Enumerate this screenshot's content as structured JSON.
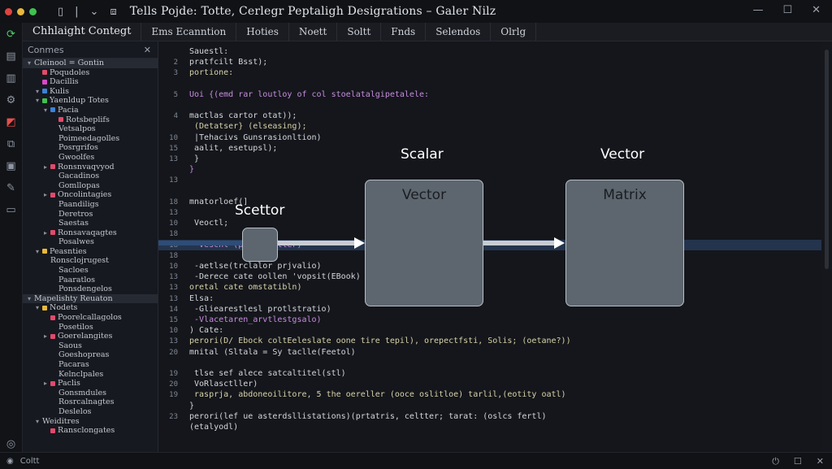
{
  "window": {
    "title": "Tells  Pojde: Totte, Cerlegr Peptaligh Desigrations – Galer Nilz",
    "dots": [
      "#e0443e",
      "#e8b93a",
      "#3fc24f"
    ],
    "controls": [
      "—",
      "☐",
      "✕"
    ]
  },
  "menubar": {
    "items": [
      "Chhlaight Contegt",
      "Ems Ecanntion",
      "Hoties",
      "Noett",
      "Soltt",
      "Fnds",
      "Selendos",
      "Olrlg"
    ]
  },
  "explorer": {
    "header": "Conmes",
    "close": "✕",
    "rows": [
      {
        "indent": 0,
        "arrow": "▾",
        "color": "",
        "label": "Cleinool = Gontin",
        "sel": true
      },
      {
        "indent": 1,
        "arrow": "",
        "color": "#e04b6b",
        "label": "Poqudoles"
      },
      {
        "indent": 1,
        "arrow": "",
        "color": "#d949c8",
        "label": "Dacillis"
      },
      {
        "indent": 1,
        "arrow": "▾",
        "color": "#3b82d6",
        "label": "Kulis"
      },
      {
        "indent": 1,
        "arrow": "▾",
        "color": "#3fc24f",
        "label": "Yaenldup Totes"
      },
      {
        "indent": 2,
        "arrow": "▾",
        "color": "#3b82d6",
        "label": "Pacia"
      },
      {
        "indent": 3,
        "arrow": "",
        "color": "#e04b6b",
        "label": "Rotsbeplifs"
      },
      {
        "indent": 3,
        "arrow": "",
        "color": "",
        "label": "Vetsalpos"
      },
      {
        "indent": 3,
        "arrow": "",
        "color": "",
        "label": "Poimeedagolles"
      },
      {
        "indent": 3,
        "arrow": "",
        "color": "",
        "label": "Posrgrifos"
      },
      {
        "indent": 3,
        "arrow": "",
        "color": "",
        "label": "Gwoolfes"
      },
      {
        "indent": 2,
        "arrow": "▸",
        "color": "#e04b6b",
        "label": "Ronsnvaqvyod"
      },
      {
        "indent": 3,
        "arrow": "",
        "color": "",
        "label": "Gacadinos"
      },
      {
        "indent": 3,
        "arrow": "",
        "color": "",
        "label": "Gomllopas"
      },
      {
        "indent": 2,
        "arrow": "▸",
        "color": "#e04b6b",
        "label": "Oncolintagies"
      },
      {
        "indent": 3,
        "arrow": "",
        "color": "",
        "label": "Paandiligs"
      },
      {
        "indent": 3,
        "arrow": "",
        "color": "",
        "label": "Deretros"
      },
      {
        "indent": 3,
        "arrow": "",
        "color": "",
        "label": "Saestas"
      },
      {
        "indent": 2,
        "arrow": "▸",
        "color": "#e04b6b",
        "label": "Ronsavaqagtes"
      },
      {
        "indent": 3,
        "arrow": "",
        "color": "",
        "label": "Posalwes"
      },
      {
        "indent": 1,
        "arrow": "▾",
        "color": "#e8b93a",
        "label": "Peasnties"
      },
      {
        "indent": 2,
        "arrow": "",
        "color": "",
        "label": "Ronsclojrugest"
      },
      {
        "indent": 3,
        "arrow": "",
        "color": "",
        "label": "Sacloes"
      },
      {
        "indent": 3,
        "arrow": "",
        "color": "",
        "label": "Paaratlos"
      },
      {
        "indent": 3,
        "arrow": "",
        "color": "",
        "label": "Ponsdengelos"
      },
      {
        "indent": 0,
        "arrow": "▾",
        "color": "",
        "label": "Mapelishty Reuaton",
        "sel": true
      },
      {
        "indent": 1,
        "arrow": "▾",
        "color": "#e8b93a",
        "label": "Nodets"
      },
      {
        "indent": 2,
        "arrow": "",
        "color": "#e04b6b",
        "label": "Poorelcallagolos"
      },
      {
        "indent": 3,
        "arrow": "",
        "color": "",
        "label": "Posetilos"
      },
      {
        "indent": 2,
        "arrow": "▸",
        "color": "#e04b6b",
        "label": "Goerelangites"
      },
      {
        "indent": 3,
        "arrow": "",
        "color": "",
        "label": "Saous"
      },
      {
        "indent": 3,
        "arrow": "",
        "color": "",
        "label": "Goeshopreas"
      },
      {
        "indent": 3,
        "arrow": "",
        "color": "",
        "label": "Pacaras"
      },
      {
        "indent": 3,
        "arrow": "",
        "color": "",
        "label": "Kelnclpales"
      },
      {
        "indent": 2,
        "arrow": "▸",
        "color": "#e04b6b",
        "label": "Paclis"
      },
      {
        "indent": 3,
        "arrow": "",
        "color": "",
        "label": "Gonsmdules"
      },
      {
        "indent": 3,
        "arrow": "",
        "color": "",
        "label": "Rosrcalnagtes"
      },
      {
        "indent": 3,
        "arrow": "",
        "color": "",
        "label": "Deslelos"
      },
      {
        "indent": 1,
        "arrow": "▾",
        "color": "",
        "label": "Weiditres"
      },
      {
        "indent": 2,
        "arrow": "",
        "color": "#e04b6b",
        "label": "Ransclongates"
      }
    ]
  },
  "editor": {
    "lines": [
      {
        "n": "",
        "t": "Sauestl:"
      },
      {
        "n": "2",
        "t": "pratfcilt Bsst);"
      },
      {
        "n": "3",
        "t": "portione:"
      },
      {
        "n": "",
        "t": ""
      },
      {
        "n": "5",
        "t": "Uoi {(emd rar loutloy of col stoelatalgipetalele:"
      },
      {
        "n": "",
        "t": ""
      },
      {
        "n": "4",
        "t": "mactlas cartor otat));"
      },
      {
        "n": "",
        "t": "  (Detatser} (elseasing);"
      },
      {
        "n": "10",
        "t": "  |Tehacivs Gunsrasionltion)"
      },
      {
        "n": "15",
        "t": "  aalit, esetupsl);"
      },
      {
        "n": "13",
        "t": "  }"
      },
      {
        "n": "",
        "t": "}"
      },
      {
        "n": "13",
        "t": ""
      },
      {
        "n": "",
        "t": ""
      },
      {
        "n": "18",
        "t": "mnatorloef(]"
      },
      {
        "n": "13",
        "t": ""
      },
      {
        "n": "10",
        "t": "  Veoctl;"
      },
      {
        "n": "18",
        "t": ""
      },
      {
        "n": "18",
        "t": "  -veschl          (proitamaller)",
        "hl": true
      },
      {
        "n": "18",
        "t": ""
      },
      {
        "n": "10",
        "t": "  -aetlse(trclalor prjvalio)"
      },
      {
        "n": "13",
        "t": "  -Derece cate oollen 'vopsit(EBook)"
      },
      {
        "n": "13",
        "t": "oretal cate omstatibln)"
      },
      {
        "n": "13",
        "t": "Elsa:"
      },
      {
        "n": "14",
        "t": "  -Gliearestlesl protlstratio)"
      },
      {
        "n": "15",
        "t": "  -Vlacetaren_arvtlestgsalo)"
      },
      {
        "n": "10",
        "t": ") Cate:"
      },
      {
        "n": "13",
        "t": "perori(D/ Ebock coltEeleslate oone tire tepil), orepectfsti, Solis; (oetane?))"
      },
      {
        "n": "20",
        "t": "mnital (Sltala = Sy taclle(Feetol)"
      },
      {
        "n": "",
        "t": ""
      },
      {
        "n": "19",
        "t": "  tlse sef alece satcaltitel(stl)"
      },
      {
        "n": "20",
        "t": "  VoRlasctller)"
      },
      {
        "n": "19",
        "t": "    rasprja, abdoneoilitore, 5 the oereller (ooce oslitloe) tarlil,(eotity oatl)"
      },
      {
        "n": "",
        "t": "}"
      },
      {
        "n": "23",
        "t": "perori(lef ue asterdsllistations)(prtatris, celtter; tarat: (oslcs fertl)"
      },
      {
        "n": "",
        "t": "(etalyodl)"
      }
    ]
  },
  "diagram": {
    "label_scettor": "Scettor",
    "label_scalar": "Scalar",
    "label_vector_top": "Vector",
    "box_vector": "Vector",
    "box_matrix": "Matrix"
  },
  "status": {
    "left": "Coltt",
    "right": [
      "⏻",
      "☐",
      "✕"
    ]
  }
}
